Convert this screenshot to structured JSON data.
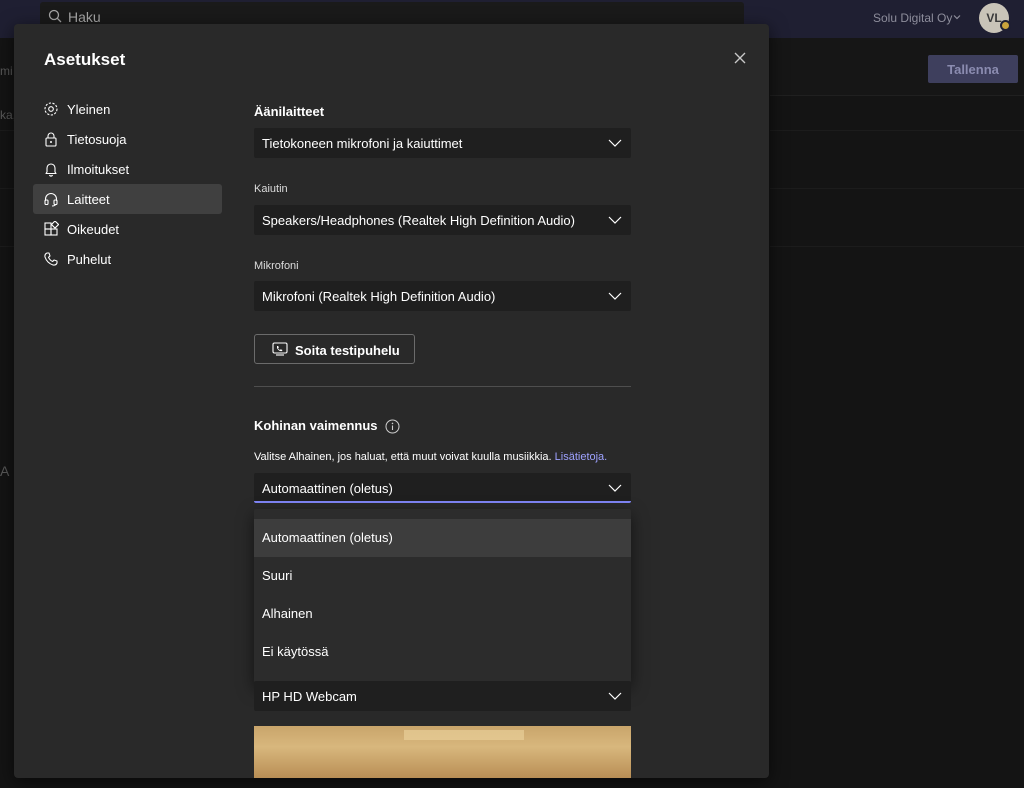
{
  "app": {
    "search_placeholder": "Haku",
    "org_name": "Solu Digital Oy",
    "avatar_initials": "VL",
    "save_button": "Tallenna",
    "bg_fragments": [
      "mi",
      "ka,",
      "A"
    ]
  },
  "dialog": {
    "title": "Asetukset",
    "nav": [
      {
        "label": "Yleinen",
        "icon": "gear-icon"
      },
      {
        "label": "Tietosuoja",
        "icon": "lock-icon"
      },
      {
        "label": "Ilmoitukset",
        "icon": "bell-icon"
      },
      {
        "label": "Laitteet",
        "icon": "headset-icon",
        "active": true
      },
      {
        "label": "Oikeudet",
        "icon": "apps-icon"
      },
      {
        "label": "Puhelut",
        "icon": "phone-icon"
      }
    ],
    "audio": {
      "heading": "Äänilaitteet",
      "device_value": "Tietokoneen mikrofoni ja kaiuttimet",
      "speaker_label": "Kaiutin",
      "speaker_value": "Speakers/Headphones (Realtek High Definition Audio)",
      "mic_label": "Mikrofoni",
      "mic_value": "Mikrofoni (Realtek High Definition Audio)",
      "test_call": "Soita testipuhelu"
    },
    "noise": {
      "heading": "Kohinan vaimennus",
      "description": "Valitse Alhainen, jos haluat, että muut voivat kuulla musiikkia.",
      "learn_more": "Lisätietoja.",
      "value": "Automaattinen (oletus)",
      "options": [
        "Automaattinen (oletus)",
        "Suuri",
        "Alhainen",
        "Ei käytössä"
      ]
    },
    "camera": {
      "value": "HP HD Webcam"
    }
  },
  "colors": {
    "accent": "#7f85f5",
    "link": "#9ea2ff",
    "dialog_bg": "#292929",
    "select_bg": "#1f1f1f"
  }
}
